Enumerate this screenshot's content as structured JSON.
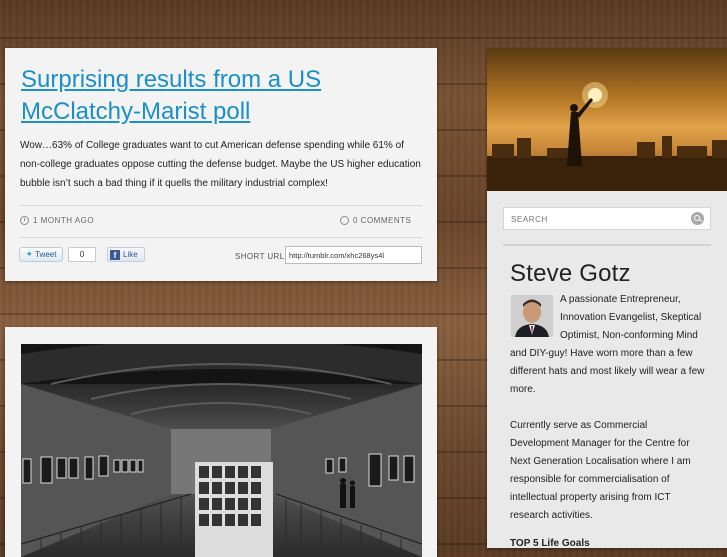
{
  "post1": {
    "title": "Surprising results from a US McClatchy-Marist poll",
    "body": "Wow…63% of College graduates want to cut American defense spending while 61% of non-college graduates oppose cutting the defense budget. Maybe the US higher education bubble isn’t such a bad thing if it quells the military industrial complex!",
    "time_ago": "1 MONTH AGO",
    "comments": "0 COMMENTS",
    "tweet_label": "Tweet",
    "tweet_count": "0",
    "like_label": "Like",
    "short_url_label": "SHORT URL",
    "short_url_value": "http://tumblr.com/xhc268ys4l"
  },
  "sidebar": {
    "search_placeholder": "SEARCH",
    "author_name": "Steve Gotz",
    "bio_paragraph_1": "A passionate Entrepreneur, Innovation Evangelist, Skeptical Optimist, Non-conforming Mind and DIY-guy! Have worn more than a few different hats and most likely will wear a few more.",
    "bio_paragraph_2": "Currently serve as Commercial Development Manager for the Centre for Next Generation Localisation where I am responsible for commercialisation of intellectual property arising from ICT research activities.",
    "next_heading": "TOP 5 Life Goals"
  },
  "colors": {
    "link": "#1a8fc9",
    "panel": "#f3f3f3",
    "sidebar": "#e9e9e9"
  },
  "icons": [
    "clock-icon",
    "comment-icon",
    "twitter-bird-icon",
    "facebook-icon",
    "search-icon"
  ]
}
